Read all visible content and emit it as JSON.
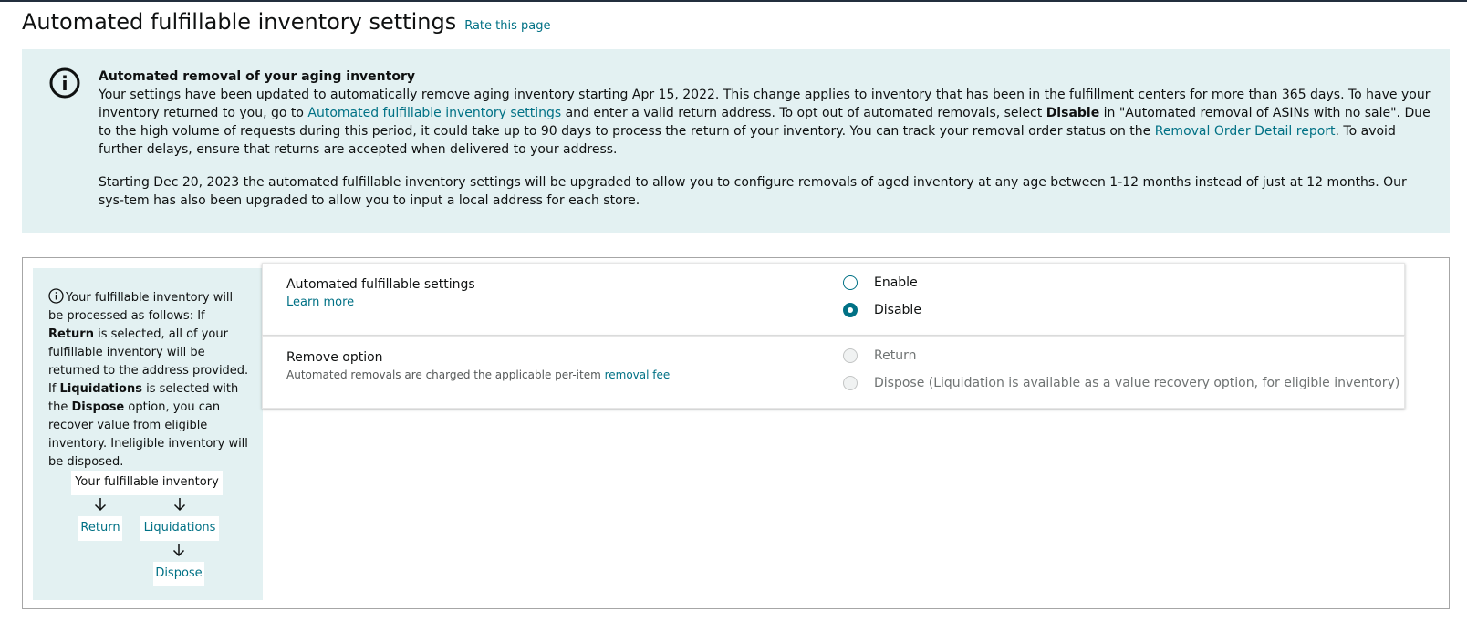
{
  "page": {
    "title": "Automated fulfillable inventory settings",
    "rate_link": "Rate this page"
  },
  "alert": {
    "icon": "info-icon",
    "heading": "Automated removal of your aging inventory",
    "p1_before_link": "Your settings have been updated to automatically remove aging inventory starting Apr 15, 2022. This change applies to inventory that has been in the fulfillment centers for more than 365 days. To have your inventory returned to you, go to ",
    "p1_link": "Automated fulfillable inventory settings",
    "p1_after_link": " and enter a valid return address. To opt out of automated removals, select ",
    "p1_bold": "Disable",
    "p1_after_bold": " in \"Automated removal of ASINs with no sale\". Due to the high volume of requests during this period, it could take up to 90 days to process the return of your inventory. You can track your removal order status on the ",
    "p1_link2": "Removal Order Detail report",
    "p1_end": ". To avoid further delays, ensure that returns are accepted when delivered to your address.",
    "p2": "Starting Dec 20, 2023 the automated fulfillable inventory settings will be upgraded to allow you to configure removals of aged inventory at any age between 1-12 months instead of just at 12 months. Our sys-tem has also been upgraded to allow you to input a local address for each store."
  },
  "side_panel": {
    "t1": "Your fulfillable inventory will be processed as follows: If ",
    "b1": "Return",
    "t2": " is selected, all of your fulfillable inventory will be returned to the address provided. If ",
    "b2": "Liquidations",
    "t3": " is selected with the ",
    "b3": "Dispose",
    "t4": " option, you can recover value from eligible inventory. Ineligible inventory will be disposed.",
    "flow": {
      "root": "Your fulfillable inventory",
      "return": "Return",
      "liquidations": "Liquidations",
      "dispose": "Dispose"
    }
  },
  "settings": {
    "automated": {
      "title": "Automated fulfillable settings",
      "learn_more": "Learn more",
      "options": [
        {
          "label": "Enable",
          "checked": false
        },
        {
          "label": "Disable",
          "checked": true
        }
      ]
    },
    "remove": {
      "title": "Remove option",
      "note_before": "Automated removals are charged the applicable per-item ",
      "note_link": "removal fee",
      "options": [
        {
          "label": "Return",
          "disabled": true
        },
        {
          "label": "Dispose (Liquidation is available as a value recovery option, for eligible inventory)",
          "disabled": true
        }
      ]
    }
  },
  "colors": {
    "accent": "#007185",
    "alert_bg": "#e3f1f2",
    "text": "#0f1111"
  }
}
